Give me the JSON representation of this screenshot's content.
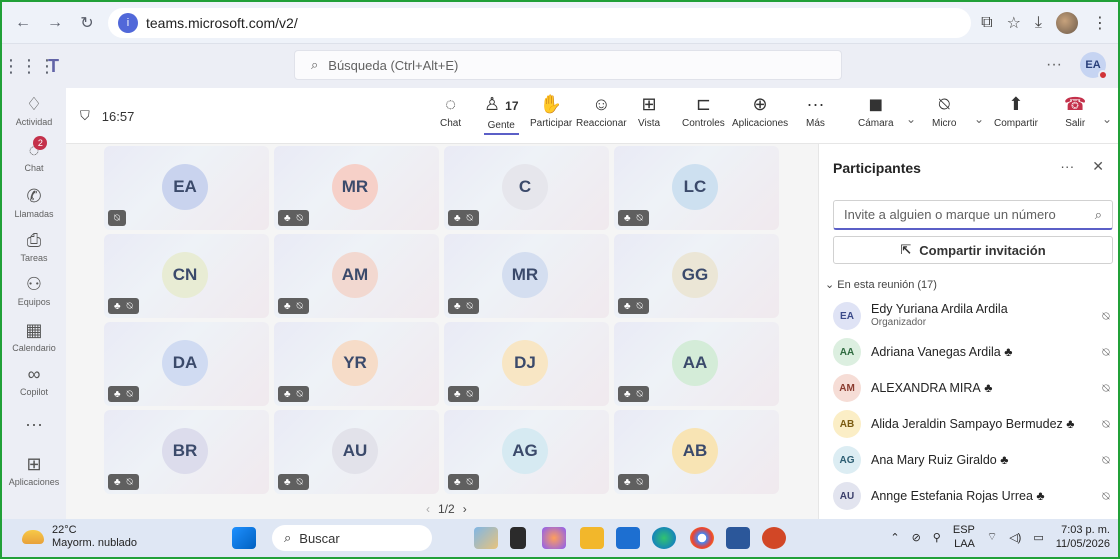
{
  "browser": {
    "url": "teams.microsoft.com/v2/"
  },
  "teams": {
    "search_placeholder": "Búsqueda (Ctrl+Alt+E)",
    "user_initials": "EA"
  },
  "rail": [
    {
      "label": "Actividad",
      "icon": "bell-icon"
    },
    {
      "label": "Chat",
      "icon": "chat-icon",
      "badge": "2"
    },
    {
      "label": "Llamadas",
      "icon": "phone-icon"
    },
    {
      "label": "Tareas",
      "icon": "tasks-icon"
    },
    {
      "label": "Equipos",
      "icon": "teams-icon"
    },
    {
      "label": "Calendario",
      "icon": "calendar-icon"
    },
    {
      "label": "Copilot",
      "icon": "copilot-icon"
    },
    {
      "label": "Aplicaciones",
      "icon": "apps-icon"
    }
  ],
  "meeting": {
    "time": "16:57",
    "people_count": "17",
    "controls": {
      "chat": "Chat",
      "people": "Gente",
      "raise": "Participar",
      "react": "Reaccionar",
      "view": "Vista",
      "controls": "Controles",
      "apps": "Aplicaciones",
      "more": "Más",
      "camera": "Cámara",
      "mic": "Micro",
      "share": "Compartir",
      "leave": "Salir"
    }
  },
  "grid": {
    "tiles": [
      {
        "initials": "EA",
        "color": "#c9d3ee"
      },
      {
        "initials": "MR",
        "color": "#f6d0c8"
      },
      {
        "initials": "C",
        "color": "#e6e6ec"
      },
      {
        "initials": "LC",
        "color": "#cde0f0"
      },
      {
        "initials": "CN",
        "color": "#e8ecd4"
      },
      {
        "initials": "AM",
        "color": "#f2d8d0"
      },
      {
        "initials": "MR",
        "color": "#d4def0"
      },
      {
        "initials": "GG",
        "color": "#ebe6d6"
      },
      {
        "initials": "DA",
        "color": "#d0dbf2"
      },
      {
        "initials": "YR",
        "color": "#f6dcc8"
      },
      {
        "initials": "DJ",
        "color": "#f8e6c4"
      },
      {
        "initials": "AA",
        "color": "#d4ecd8"
      },
      {
        "initials": "BR",
        "color": "#dcdcec"
      },
      {
        "initials": "AU",
        "color": "#e2e2ea"
      },
      {
        "initials": "AG",
        "color": "#d6eaf2"
      },
      {
        "initials": "AB",
        "color": "#f8e4b4"
      }
    ],
    "pager": "1/2"
  },
  "panel": {
    "title": "Participantes",
    "invite_placeholder": "Invite a alguien o marque un número",
    "share_label": "Compartir invitación",
    "section": "En esta reunión (17)",
    "participants": [
      {
        "initials": "EA",
        "name": "Edy Yuriana Ardila Ardila",
        "role": "Organizador",
        "bg": "#dfe3f5",
        "fg": "#3b4a8a"
      },
      {
        "initials": "AA",
        "name": "Adriana Vanegas Ardila",
        "role": "",
        "bg": "#dcefe0",
        "fg": "#2f6b40"
      },
      {
        "initials": "AM",
        "name": "ALEXANDRA MIRA",
        "role": "",
        "bg": "#f6ddd6",
        "fg": "#8a3b2e"
      },
      {
        "initials": "AB",
        "name": "Alida Jeraldin Sampayo Bermudez",
        "role": "",
        "bg": "#fbeec6",
        "fg": "#7a5a10"
      },
      {
        "initials": "AG",
        "name": "Ana Mary Ruiz Giraldo",
        "role": "",
        "bg": "#dcedf3",
        "fg": "#2b5d72"
      },
      {
        "initials": "AU",
        "name": "Annge Estefania Rojas Urrea",
        "role": "",
        "bg": "#e2e4ef",
        "fg": "#3b3f6b"
      }
    ]
  },
  "taskbar": {
    "temp": "22°C",
    "weather": "Mayorm. nublado",
    "search": "Buscar",
    "lang1": "ESP",
    "lang2": "LAA",
    "time": "7:03 p. m.",
    "date": "11/05/2026"
  }
}
